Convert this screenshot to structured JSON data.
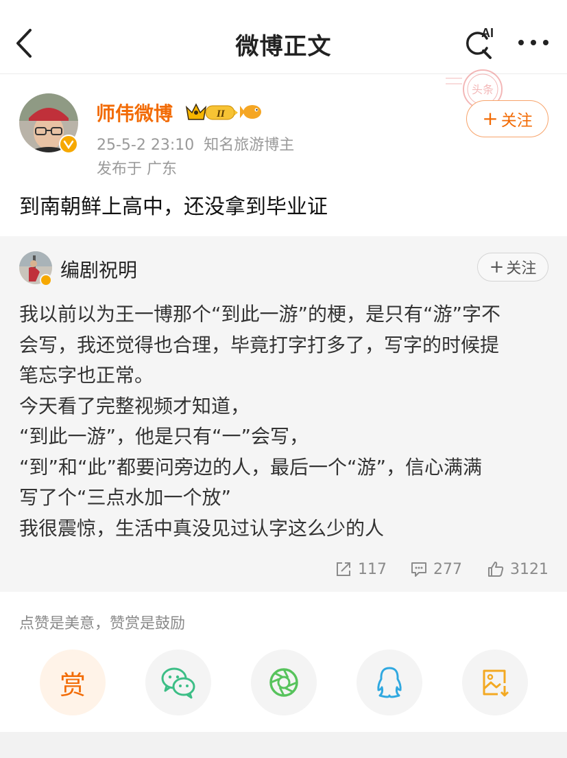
{
  "header": {
    "title": "微博正文",
    "ai_label": "AI"
  },
  "post": {
    "author": "师伟微博",
    "member_level": "II",
    "time": "25-5-2 23:10",
    "author_title": "知名旅游博主",
    "location": "发布于 广东",
    "follow_label": "关注",
    "text": "到南朝鲜上高中，还没拿到毕业证",
    "stamp_text": "头条"
  },
  "repost": {
    "author": "编剧祝明",
    "follow_label": "关注",
    "lines": [
      "我以前以为王一博那个“到此一游”的梗，是只有“游”字不",
      "会写，我还觉得也合理，毕竟打字打多了，写字的时候提",
      "笔忘字也正常。",
      "今天看了完整视频才知道，",
      "“到此一游”，他是只有“一”会写，",
      "“到”和“此”都要问旁边的人，最后一个“游”，信心满满",
      "写了个“三点水加一个放”",
      "我很震惊，生活中真没见过认字这么少的人"
    ],
    "stats": {
      "reposts": "117",
      "comments": "277",
      "likes": "3121"
    }
  },
  "reward": {
    "tip": "点赞是美意，赞赏是鼓励",
    "button_label": "赏"
  },
  "share_icons": [
    "reward-icon",
    "wechat-icon",
    "moments-icon",
    "qq-icon",
    "save-image-icon"
  ],
  "colors": {
    "accent": "#f26b05",
    "wechat": "#3cbe86",
    "moments": "#57c35c",
    "qq": "#2fa8e0",
    "save": "#f3a922"
  }
}
